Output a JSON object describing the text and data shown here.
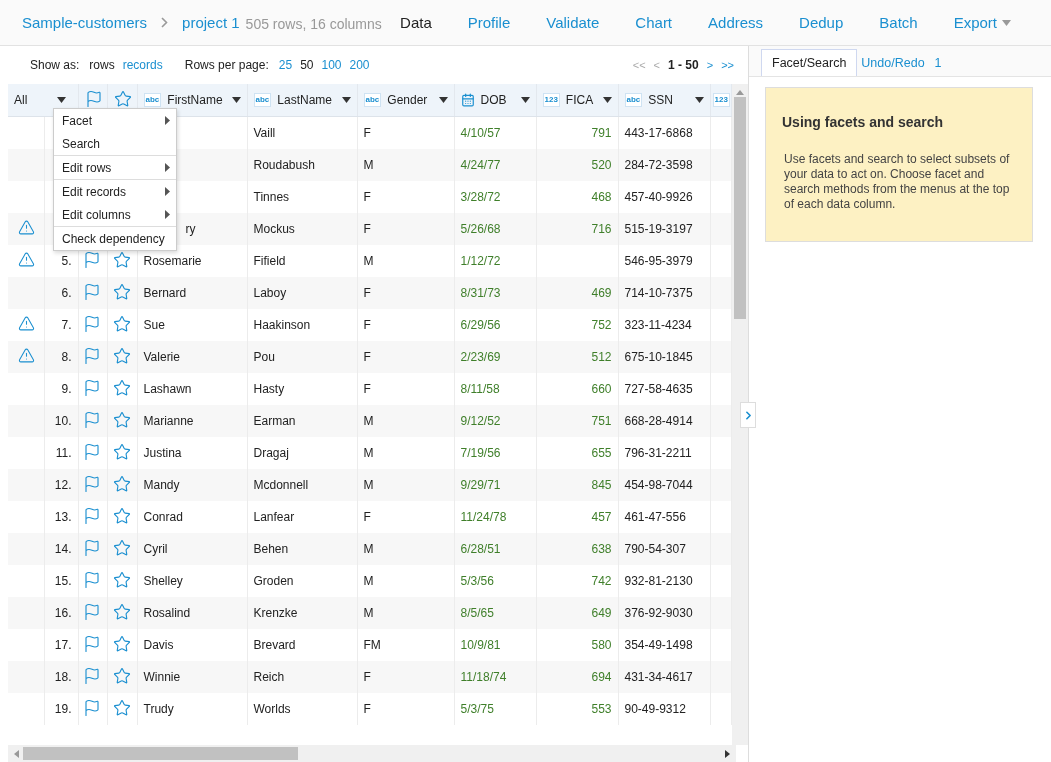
{
  "breadcrumb": {
    "project_group": "Sample-customers",
    "project": "project 1",
    "summary": "505 rows, 16 columns"
  },
  "nav": [
    {
      "label": "Data",
      "selected": true,
      "dropdown": false
    },
    {
      "label": "Profile",
      "selected": false,
      "dropdown": false
    },
    {
      "label": "Validate",
      "selected": false,
      "dropdown": false
    },
    {
      "label": "Chart",
      "selected": false,
      "dropdown": false
    },
    {
      "label": "Address",
      "selected": false,
      "dropdown": false
    },
    {
      "label": "Dedup",
      "selected": false,
      "dropdown": false
    },
    {
      "label": "Batch",
      "selected": false,
      "dropdown": false
    },
    {
      "label": "Export",
      "selected": false,
      "dropdown": true
    }
  ],
  "toolbar": {
    "show_as_label": "Show as:",
    "show_as": [
      {
        "label": "rows",
        "selected": true
      },
      {
        "label": "records",
        "selected": false
      }
    ],
    "rows_per_page_label": "Rows per page:",
    "page_sizes": [
      {
        "label": "25",
        "selected": false
      },
      {
        "label": "50",
        "selected": true
      },
      {
        "label": "100",
        "selected": false
      },
      {
        "label": "200",
        "selected": false
      }
    ],
    "pager": [
      {
        "label": "<<",
        "kind": "link",
        "disabled": true
      },
      {
        "label": "<",
        "kind": "link",
        "disabled": true
      },
      {
        "label": "1 - 50",
        "kind": "range"
      },
      {
        "label": ">",
        "kind": "link",
        "disabled": false
      },
      {
        "label": ">>",
        "kind": "link",
        "disabled": false
      }
    ]
  },
  "table": {
    "all_label": "All",
    "columns": [
      {
        "kind": "text",
        "badge": "abc",
        "label": "FirstName"
      },
      {
        "kind": "text",
        "badge": "abc",
        "label": "LastName"
      },
      {
        "kind": "text",
        "badge": "abc",
        "label": "Gender"
      },
      {
        "kind": "date",
        "label": "DOB"
      },
      {
        "kind": "number",
        "badge": "123",
        "label": "FICA"
      },
      {
        "kind": "text",
        "badge": "abc",
        "label": "SSN"
      },
      {
        "kind": "number",
        "badge": "123"
      }
    ],
    "rows": [
      {
        "warning": false,
        "last_name": "Vaill",
        "gender": "F",
        "dob": "4/10/57",
        "fica": "791",
        "ssn": "443-17-6868"
      },
      {
        "warning": false,
        "last_name": "Roudabush",
        "gender": "M",
        "dob": "4/24/77",
        "fica": "520",
        "ssn": "284-72-3598"
      },
      {
        "warning": false,
        "last_name": "Tinnes",
        "gender": "F",
        "dob": "3/28/72",
        "fica": "468",
        "ssn": "457-40-9926"
      },
      {
        "warning": true,
        "first_name": "ry",
        "last_name": "Mockus",
        "gender": "F",
        "dob": "5/26/68",
        "fica": "716",
        "ssn": "515-19-3197"
      },
      {
        "warning": true,
        "index": "5.",
        "flagged": false,
        "starred": false,
        "first_name": "Rosemarie",
        "last_name": "Fifield",
        "gender": "M",
        "dob": "1/12/72",
        "ssn": "546-95-3979"
      },
      {
        "warning": false,
        "index": "6.",
        "flagged": false,
        "starred": false,
        "first_name": "Bernard",
        "last_name": "Laboy",
        "gender": "F",
        "dob": "8/31/73",
        "fica": "469",
        "ssn": "714-10-7375"
      },
      {
        "warning": true,
        "index": "7.",
        "flagged": false,
        "starred": false,
        "first_name": "Sue",
        "last_name": "Haakinson",
        "gender": "F",
        "dob": "6/29/56",
        "fica": "752",
        "ssn": "323-11-4234"
      },
      {
        "warning": true,
        "index": "8.",
        "flagged": false,
        "starred": false,
        "first_name": "Valerie",
        "last_name": "Pou",
        "gender": "F",
        "dob": "2/23/69",
        "fica": "512",
        "ssn": "675-10-1845"
      },
      {
        "warning": false,
        "index": "9.",
        "flagged": false,
        "starred": false,
        "first_name": "Lashawn",
        "last_name": "Hasty",
        "gender": "F",
        "dob": "8/11/58",
        "fica": "660",
        "ssn": "727-58-4635"
      },
      {
        "warning": false,
        "index": "10.",
        "flagged": false,
        "starred": false,
        "first_name": "Marianne",
        "last_name": "Earman",
        "gender": "M",
        "dob": "9/12/52",
        "fica": "751",
        "ssn": "668-28-4914"
      },
      {
        "warning": false,
        "index": "11.",
        "flagged": false,
        "starred": false,
        "first_name": "Justina",
        "last_name": "Dragaj",
        "gender": "M",
        "dob": "7/19/56",
        "fica": "655",
        "ssn": "796-31-2211"
      },
      {
        "warning": false,
        "index": "12.",
        "flagged": false,
        "starred": false,
        "first_name": "Mandy",
        "last_name": "Mcdonnell",
        "gender": "M",
        "dob": "9/29/71",
        "fica": "845",
        "ssn": "454-98-7044"
      },
      {
        "warning": false,
        "index": "13.",
        "flagged": false,
        "starred": false,
        "first_name": "Conrad",
        "last_name": "Lanfear",
        "gender": "F",
        "dob": "11/24/78",
        "fica": "457",
        "ssn": "461-47-556"
      },
      {
        "warning": false,
        "index": "14.",
        "flagged": false,
        "starred": false,
        "first_name": "Cyril",
        "last_name": "Behen",
        "gender": "M",
        "dob": "6/28/51",
        "fica": "638",
        "ssn": "790-54-307"
      },
      {
        "warning": false,
        "index": "15.",
        "flagged": false,
        "starred": false,
        "first_name": "Shelley",
        "last_name": "Groden",
        "gender": "M",
        "dob": "5/3/56",
        "fica": "742",
        "ssn": "932-81-2130"
      },
      {
        "warning": false,
        "index": "16.",
        "flagged": false,
        "starred": false,
        "first_name": "Rosalind",
        "last_name": "Krenzke",
        "gender": "M",
        "dob": "8/5/65",
        "fica": "649",
        "ssn": "376-92-9030"
      },
      {
        "warning": false,
        "index": "17.",
        "flagged": false,
        "starred": false,
        "first_name": "Davis",
        "last_name": "Brevard",
        "gender": "FM",
        "dob": "10/9/81",
        "fica": "580",
        "ssn": "354-49-1498"
      },
      {
        "warning": false,
        "index": "18.",
        "flagged": false,
        "starred": false,
        "first_name": "Winnie",
        "last_name": "Reich",
        "gender": "F",
        "dob": "11/18/74",
        "fica": "694",
        "ssn": "431-34-4617"
      },
      {
        "warning": false,
        "index": "19.",
        "flagged": false,
        "starred": false,
        "first_name": "Trudy",
        "last_name": "Worlds",
        "gender": "F",
        "dob": "5/3/75",
        "fica": "553",
        "ssn": "90-49-9312"
      }
    ]
  },
  "menu": {
    "groups": [
      [
        {
          "label": "Facet",
          "submenu": true
        },
        {
          "label": "Search",
          "submenu": false
        }
      ],
      [
        {
          "label": "Edit rows",
          "submenu": true
        }
      ],
      [
        {
          "label": "Edit records",
          "submenu": true
        },
        {
          "label": "Edit columns",
          "submenu": true
        }
      ],
      [
        {
          "label": "Check dependency",
          "submenu": false
        }
      ]
    ]
  },
  "side_panel": {
    "tabs": [
      {
        "label": "Facet/Search",
        "selected": true
      },
      {
        "label": "Undo/Redo",
        "count": "1",
        "selected": false
      }
    ],
    "help": {
      "title": "Using facets and search",
      "body": "Use facets and search to select subsets of your data to act on. Choose facet and search methods from the menus at the top of each data column."
    }
  }
}
